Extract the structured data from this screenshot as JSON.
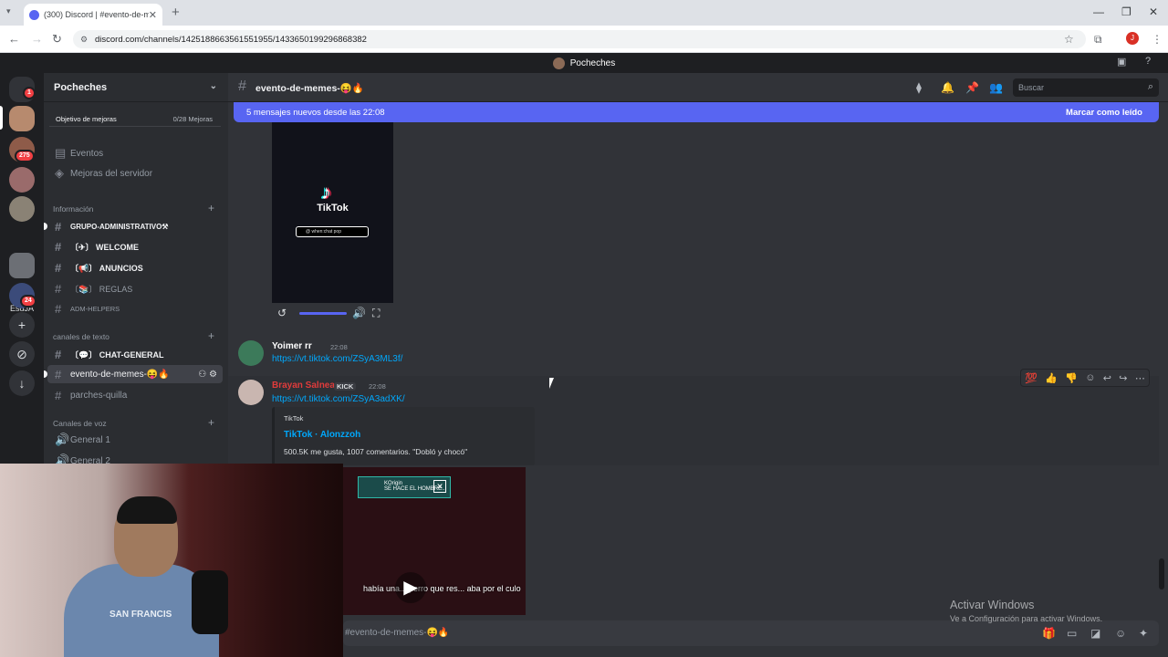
{
  "browser": {
    "tab_title": "(300) Discord | #evento-de-me...",
    "url": "discord.com/channels/1425188663561551955/1433650199296868382",
    "profile_initial": "J"
  },
  "app_title": "Pocheches",
  "servers": {
    "badges": [
      "1",
      "275",
      "24"
    ],
    "text_server": "EsdJA"
  },
  "sidebar": {
    "server_name": "Pocheches",
    "boost_label": "Objetivo de mejoras",
    "boost_count": "0/28 Mejoras",
    "events": "Eventos",
    "server_boosts": "Mejoras del servidor",
    "cat_info": "Información",
    "cat_text": "canales de texto",
    "cat_voice": "Canales de voz",
    "channels": {
      "grupo": "GRUPO-ADMINISTRATIVO⚒",
      "welcome": "〔✈〕 WELCOME",
      "anuncios": "〔📢〕 ANUNCIOS",
      "reglas": "〔📚〕 REGLAS",
      "adm": "ADM-HELPERS",
      "chat": "〔💬〕 CHAT-GENERAL",
      "evento": "evento-de-memes-😝🔥",
      "parches": "parches-quilla",
      "general1": "General 1",
      "general2": "General 2"
    }
  },
  "header": {
    "channel": "evento-de-memes-😝🔥",
    "search_placeholder": "Buscar"
  },
  "new_messages": {
    "text": "5 mensajes nuevos desde las 22:08",
    "mark": "Marcar como leído"
  },
  "video1": {
    "brand": "TikTok",
    "search_text": "@ when:chat pop"
  },
  "messages": [
    {
      "user": "Yoimer rr",
      "time": "22:08",
      "link": "https://vt.tiktok.com/ZSyA3ML3f/"
    },
    {
      "user": "Brayan Salnea",
      "tag": "KICK",
      "time": "22:08",
      "link": "https://vt.tiktok.com/ZSyA3adXK/"
    }
  ],
  "embed": {
    "provider": "TikTok",
    "title": "TikTok · Alonzzoh",
    "desc": "500.5K me gusta, 1007 comentarios. \"Dobló y chocó\"",
    "overlay_brand": "KOrigin",
    "overlay_sub": "SE HACE EL HOMBRE...",
    "subtitle": "había una... perro que res... aba por el culo"
  },
  "composer": {
    "placeholder": "#evento-de-memes-😝🔥"
  },
  "watermark": {
    "line1": "Activar Windows",
    "line2": "Ve a Configuración para activar Windows."
  },
  "webcam": {
    "shirt_text": "SAN FRANCIS"
  },
  "colors": {
    "accent": "#5865f2",
    "link": "#00a8fc",
    "user2": "#e03b3b",
    "user1": "#ffffff"
  }
}
